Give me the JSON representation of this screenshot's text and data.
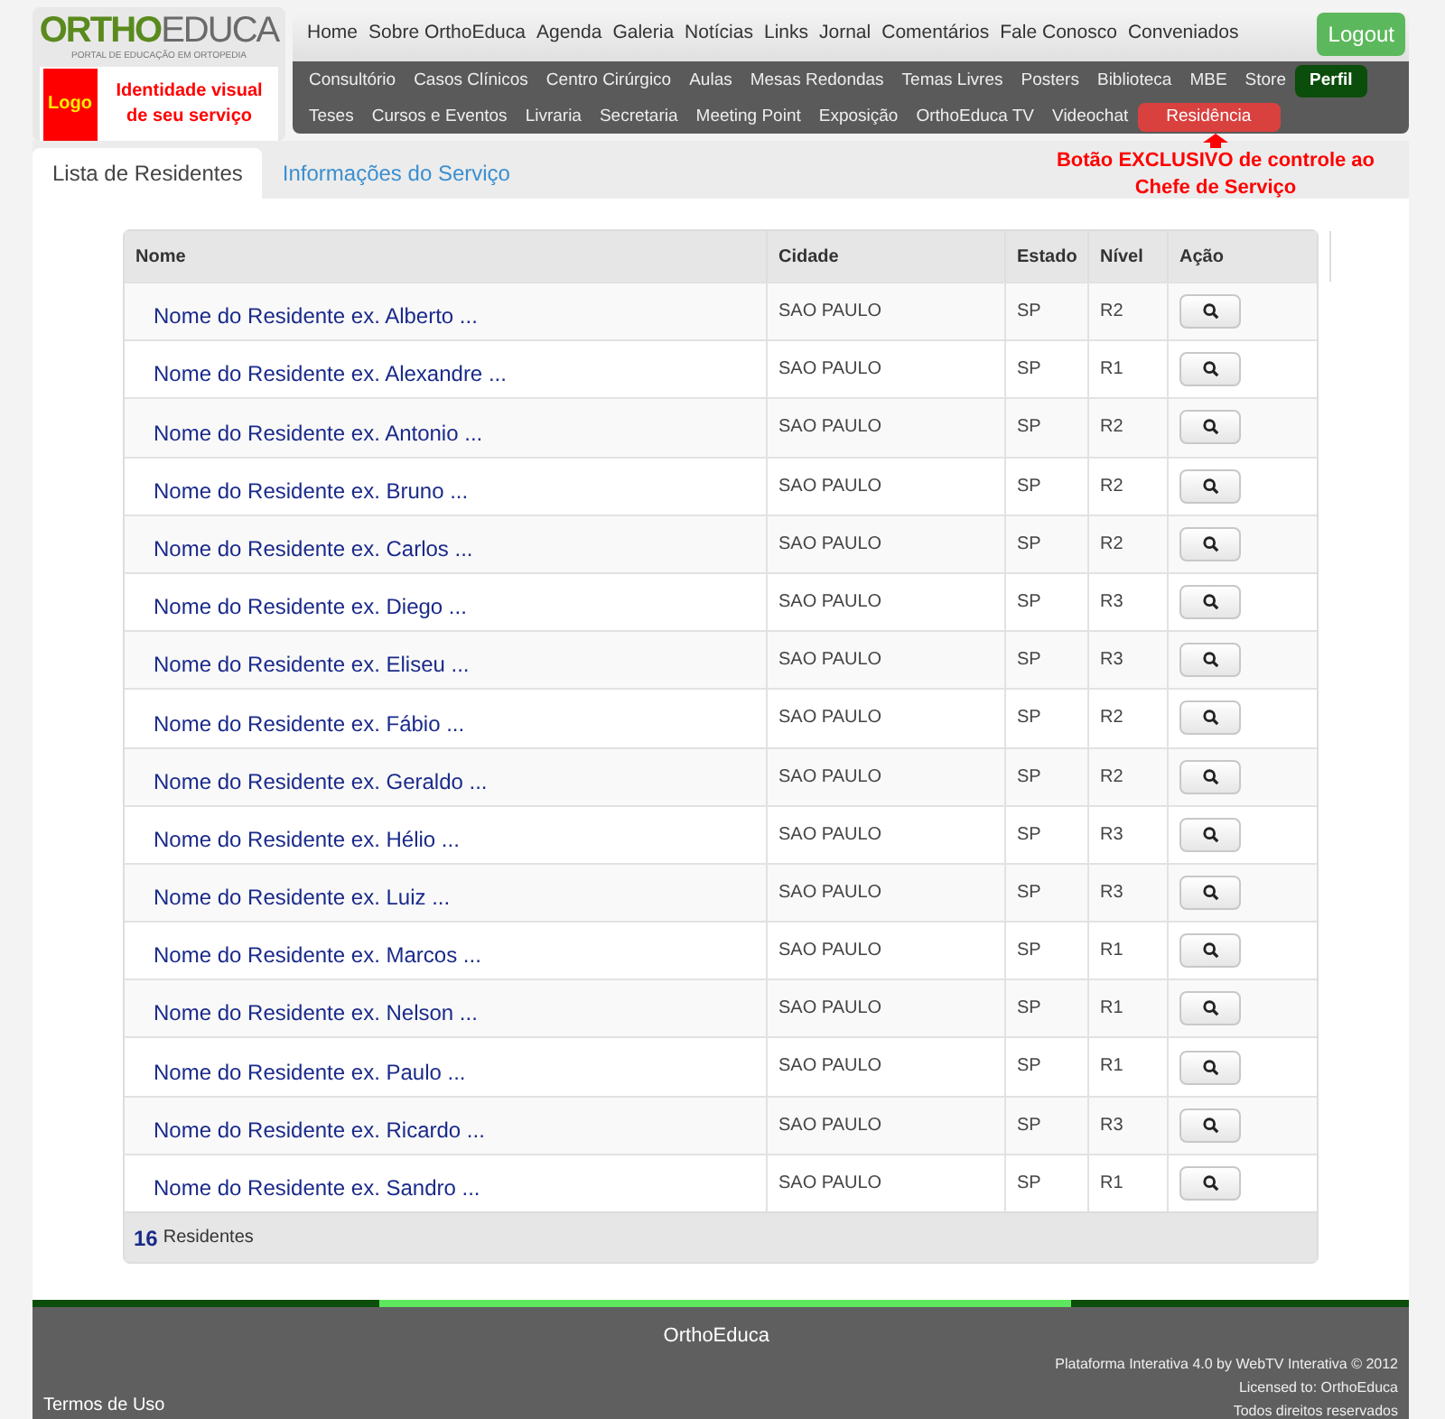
{
  "logo": {
    "part1": "ORTHO",
    "part2": "EDUCA",
    "tagline": "PORTAL DE EDUCAÇÃO EM ORTOPEDIA",
    "badge": "Logo",
    "identity": "Identidade visual de seu serviço"
  },
  "main_nav": [
    "Home",
    "Sobre OrthoEduca",
    "Agenda",
    "Galeria",
    "Notícias",
    "Links",
    "Jornal",
    "Comentários",
    "Fale Conosco",
    "Conveniados"
  ],
  "logout": "Logout",
  "sub_nav": [
    [
      {
        "label": "Consultório",
        "kind": "link"
      },
      {
        "label": "Casos Clínicos",
        "kind": "link"
      },
      {
        "label": "Centro Cirúrgico",
        "kind": "link"
      },
      {
        "label": "Aulas",
        "kind": "link"
      },
      {
        "label": "Mesas Redondas",
        "kind": "link"
      },
      {
        "label": "Temas Livres",
        "kind": "link"
      },
      {
        "label": "Posters",
        "kind": "link"
      },
      {
        "label": "Biblioteca",
        "kind": "link"
      },
      {
        "label": "MBE",
        "kind": "link"
      },
      {
        "label": "Store",
        "kind": "link"
      },
      {
        "label": "Perfil",
        "kind": "profile"
      }
    ],
    [
      {
        "label": "Teses",
        "kind": "link"
      },
      {
        "label": "Cursos e Eventos",
        "kind": "link"
      },
      {
        "label": "Livraria",
        "kind": "link"
      },
      {
        "label": "Secretaria",
        "kind": "link"
      },
      {
        "label": "Meeting Point",
        "kind": "link"
      },
      {
        "label": "Exposição",
        "kind": "link"
      },
      {
        "label": "OrthoEduca TV",
        "kind": "link"
      },
      {
        "label": "Videochat",
        "kind": "link"
      },
      {
        "label": "Residência",
        "kind": "highlight"
      }
    ]
  ],
  "annotation": "Botão EXCLUSIVO de controle ao Chefe de Serviço",
  "tabs": [
    {
      "label": "Lista de Residentes",
      "selected": true
    },
    {
      "label": "Informações do Serviço",
      "selected": false
    }
  ],
  "table": {
    "columns": [
      "Nome",
      "Cidade",
      "Estado",
      "Nível",
      "Ação"
    ],
    "rows": [
      {
        "name": "Nome do Residente ex. Alberto ...",
        "city": "SAO PAULO",
        "state": "SP",
        "level": "R2"
      },
      {
        "name": "Nome do Residente ex. Alexandre ...",
        "city": "SAO PAULO",
        "state": "SP",
        "level": "R1"
      },
      {
        "name": "Nome do Residente ex. Antonio ...",
        "city": "SAO PAULO",
        "state": "SP",
        "level": "R2"
      },
      {
        "name": "Nome do Residente ex. Bruno ...",
        "city": "SAO PAULO",
        "state": "SP",
        "level": "R2"
      },
      {
        "name": "Nome do Residente ex. Carlos ...",
        "city": "SAO PAULO",
        "state": "SP",
        "level": "R2"
      },
      {
        "name": "Nome do Residente ex. Diego ...",
        "city": "SAO PAULO",
        "state": "SP",
        "level": "R3"
      },
      {
        "name": "Nome do Residente ex. Eliseu ...",
        "city": "SAO PAULO",
        "state": "SP",
        "level": "R3"
      },
      {
        "name": "Nome do Residente ex. Fábio ...",
        "city": "SAO PAULO",
        "state": "SP",
        "level": "R2"
      },
      {
        "name": "Nome do Residente ex. Geraldo ...",
        "city": "SAO PAULO",
        "state": "SP",
        "level": "R2"
      },
      {
        "name": "Nome do Residente ex. Hélio ...",
        "city": "SAO PAULO",
        "state": "SP",
        "level": "R3"
      },
      {
        "name": "Nome do Residente ex. Luiz ...",
        "city": "SAO PAULO",
        "state": "SP",
        "level": "R3"
      },
      {
        "name": "Nome do Residente ex. Marcos ...",
        "city": "SAO PAULO",
        "state": "SP",
        "level": "R1"
      },
      {
        "name": "Nome do Residente ex. Nelson ...",
        "city": "SAO PAULO",
        "state": "SP",
        "level": "R1"
      },
      {
        "name": "Nome do Residente ex. Paulo ...",
        "city": "SAO PAULO",
        "state": "SP",
        "level": "R1"
      },
      {
        "name": "Nome do Residente ex. Ricardo ...",
        "city": "SAO PAULO",
        "state": "SP",
        "level": "R3"
      },
      {
        "name": "Nome do Residente ex. Sandro ...",
        "city": "SAO PAULO",
        "state": "SP",
        "level": "R1"
      }
    ],
    "count": "16",
    "count_label": "Residentes"
  },
  "footer": {
    "title": "OrthoEduca",
    "terms": "Termos de Uso",
    "lines": [
      "Plataforma Interativa 4.0 by WebTV Interativa © 2012",
      "Licensed to: OrthoEduca",
      "Todos direitos reservados"
    ]
  }
}
